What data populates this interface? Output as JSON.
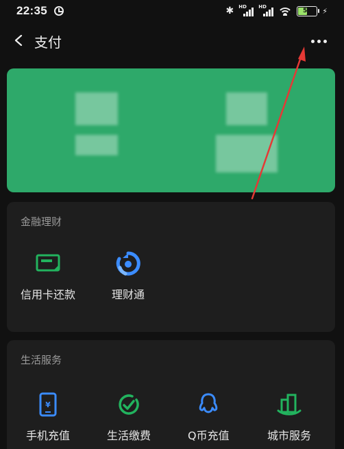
{
  "status_bar": {
    "time": "22:35",
    "network_label_1": "HD",
    "network_label_2": "HD",
    "battery_percent": "50",
    "battery_level": 0.5
  },
  "nav": {
    "title": "支付"
  },
  "finance_section": {
    "title": "金融理财",
    "items": [
      {
        "label": "信用卡还款",
        "icon": "credit-card-icon"
      },
      {
        "label": "理财通",
        "icon": "wealth-icon"
      }
    ]
  },
  "life_section": {
    "title": "生活服务",
    "items": [
      {
        "label": "手机充值",
        "icon": "phone-recharge-icon"
      },
      {
        "label": "生活缴费",
        "icon": "bill-payment-icon"
      },
      {
        "label": "Q币充值",
        "icon": "qq-coin-icon"
      },
      {
        "label": "城市服务",
        "icon": "city-service-icon"
      }
    ]
  },
  "colors": {
    "wallet_card": "#2ea96a",
    "icon_green": "#22b35e",
    "icon_blue": "#3b8cff",
    "annotation_red": "#e53935"
  }
}
